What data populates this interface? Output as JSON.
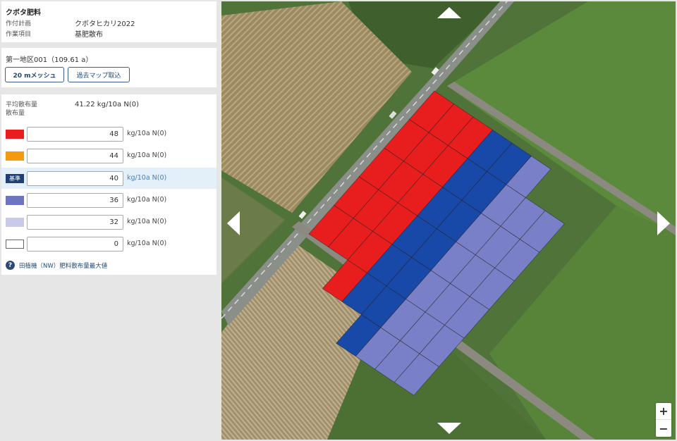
{
  "app": {
    "title": "クボタ肥料"
  },
  "plan": {
    "rows": [
      {
        "label": "作付計画",
        "value": "クボタヒカリ2022"
      },
      {
        "label": "作業項目",
        "value": "基肥散布"
      }
    ]
  },
  "area": {
    "title": "第一地区001（109.61 a）",
    "mesh_button": "20 mメッシュ",
    "past_map_button": "過去マップ取込"
  },
  "rates": {
    "average_label": "平均散布量\n散布量",
    "average_value": "41.22 kg/10a N(0)",
    "unit": "kg/10a N(0)",
    "base_tag": "基準",
    "rows": [
      {
        "value": "48",
        "color": "#e81e1e"
      },
      {
        "value": "44",
        "color": "#f29a12"
      },
      {
        "value": "40",
        "color": "#1f3f78"
      },
      {
        "value": "36",
        "color": "#6e74c0"
      },
      {
        "value": "32",
        "color": "#c9c9ea"
      },
      {
        "value": "0",
        "color": "#ffffff"
      }
    ],
    "help_text": "田植機（NW）肥料散布量最大値"
  },
  "map": {
    "zoom_in": "+",
    "zoom_out": "−",
    "mesh_colors": {
      "high": "#e81e1e",
      "base": "#1848a8",
      "low": "#7a80c8"
    }
  }
}
